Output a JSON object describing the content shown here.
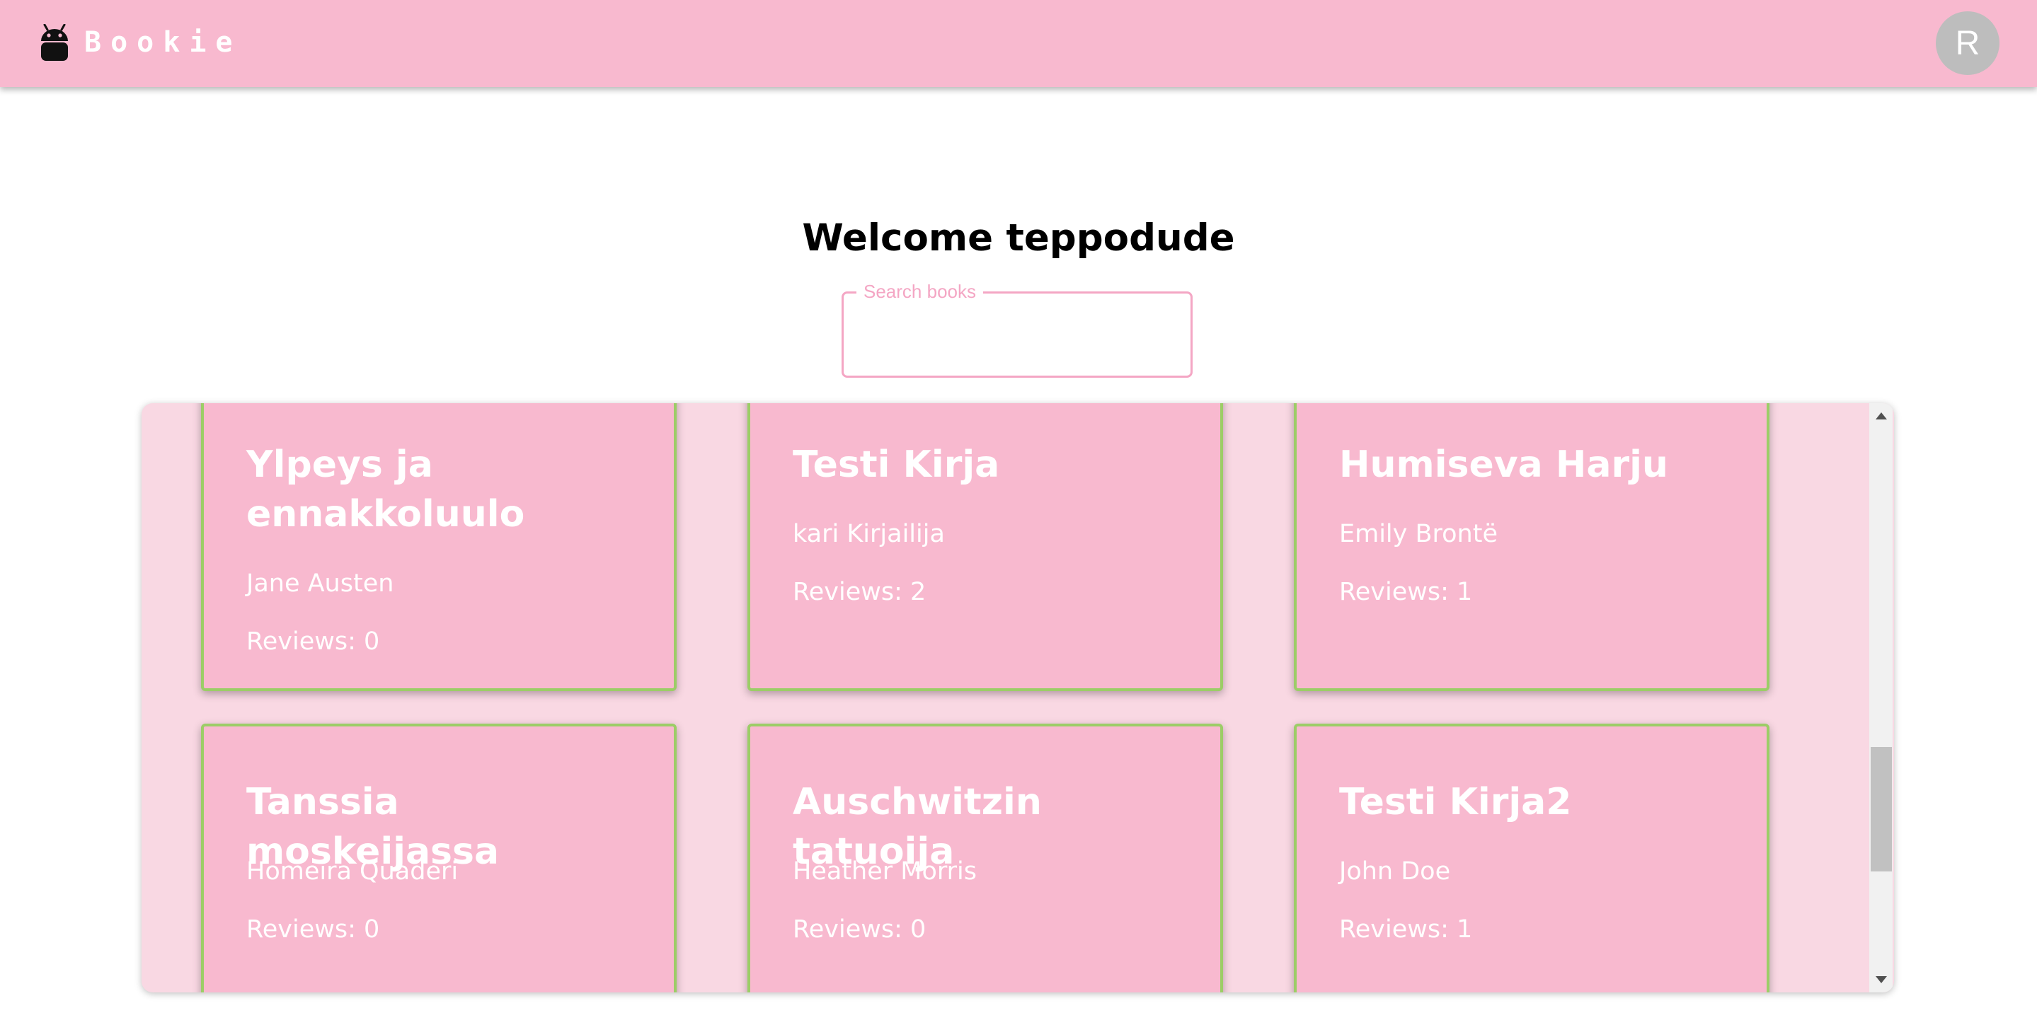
{
  "appbar": {
    "brand": "Bookie",
    "avatar_initial": "R",
    "logo_icon": "android-icon",
    "color": "#f8b9cf"
  },
  "welcome": {
    "title": "Welcome teppodude"
  },
  "search": {
    "label": "Search books",
    "value": ""
  },
  "books": [
    {
      "title": "Ylpeys ja ennakkoluulo",
      "author": "Jane Austen",
      "reviews": "Reviews: 0"
    },
    {
      "title": "Testi Kirja",
      "author": "kari Kirjailija",
      "reviews": "Reviews: 2"
    },
    {
      "title": "Humiseva Harju",
      "author": "Emily Brontë",
      "reviews": "Reviews: 1"
    },
    {
      "title": "Tanssia moskeijassa",
      "author": "Homeira Quaderi",
      "reviews": "Reviews: 0"
    },
    {
      "title": "Auschwitzin tatuoija",
      "author": "Heather Morris",
      "reviews": "Reviews: 0"
    },
    {
      "title": "Testi Kirja2",
      "author": "John Doe",
      "reviews": "Reviews: 1"
    }
  ],
  "colors": {
    "card": "#f8b9cf",
    "card_border": "#9ccd67",
    "panel": "#f9d8e3",
    "search_border": "#f4a6c4"
  }
}
